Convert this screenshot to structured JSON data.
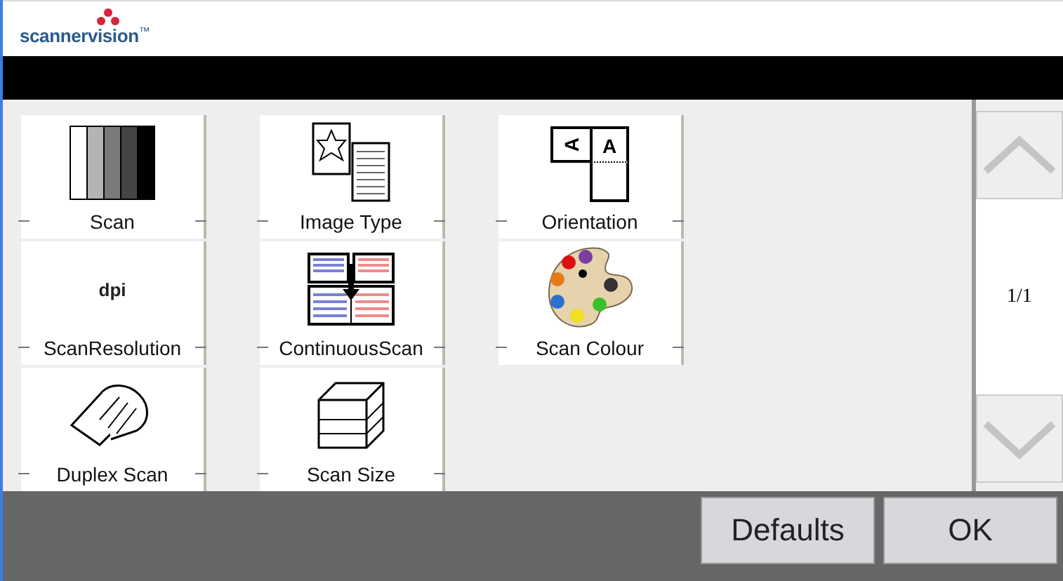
{
  "header": {
    "logo": "scannervision",
    "trademark": "™"
  },
  "tiles": [
    {
      "kind": "scan",
      "label": "Scan"
    },
    {
      "kind": "image-type",
      "label": "Image Type"
    },
    {
      "kind": "orientation",
      "label": "Orientation",
      "icon_texts": [
        "A",
        "A"
      ]
    },
    {
      "kind": "dpi",
      "label": "ScanResolution",
      "icon_texts": [
        "dpi"
      ]
    },
    {
      "kind": "continuous",
      "label": "ContinuousScan"
    },
    {
      "kind": "palette",
      "label": "Scan Colour"
    },
    {
      "kind": "duplex",
      "label": "Duplex Scan"
    },
    {
      "kind": "size",
      "label": "Scan Size"
    }
  ],
  "pager": {
    "page": "1/1"
  },
  "buttons": [
    "Defaults",
    "OK"
  ]
}
